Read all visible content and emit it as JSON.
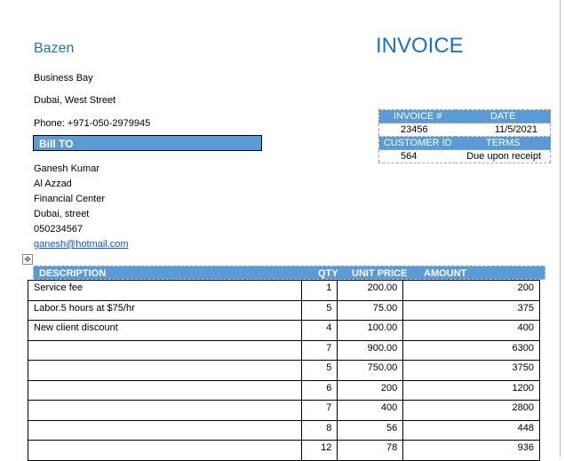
{
  "company": {
    "name": "Bazen",
    "address1": "Business Bay",
    "address2": "Dubai, West Street",
    "phone": "Phone: +971-050-2979945"
  },
  "title": "INVOICE",
  "bill_to": {
    "label": "Bill TO",
    "lines": [
      "Ganesh Kumar",
      "Al Azzad",
      "Financial Center",
      "Dubai, street",
      "050234567"
    ],
    "email": "ganesh@hotmail.com"
  },
  "info": {
    "invoice_label": "INVOICE #",
    "date_label": "DATE",
    "invoice_no": "23456",
    "date": "11/5/2021",
    "customer_label": "CUSTOMER ID",
    "terms_label": "TERMS",
    "customer_id": "564",
    "terms": "Due upon receipt"
  },
  "table": {
    "headers": [
      "DESCRIPTION",
      "QTY",
      "UNIT PRICE",
      "AMOUNT"
    ],
    "rows": [
      [
        "Service fee",
        "1",
        "200.00",
        "200"
      ],
      [
        "Labor.5 hours at $75/hr",
        "5",
        "75.00",
        "375"
      ],
      [
        "New client discount",
        "4",
        "100.00",
        "400"
      ],
      [
        "",
        "7",
        "900.00",
        "6300"
      ],
      [
        "",
        "5",
        "750.00",
        "3750"
      ],
      [
        "",
        "6",
        "200",
        "1200"
      ],
      [
        "",
        "7",
        "400",
        "2800"
      ],
      [
        "",
        "8",
        "56",
        "448"
      ],
      [
        "",
        "12",
        "78",
        "936"
      ]
    ]
  },
  "colors": {
    "accent": "#5b9bd5",
    "title": "#1a73c0"
  }
}
